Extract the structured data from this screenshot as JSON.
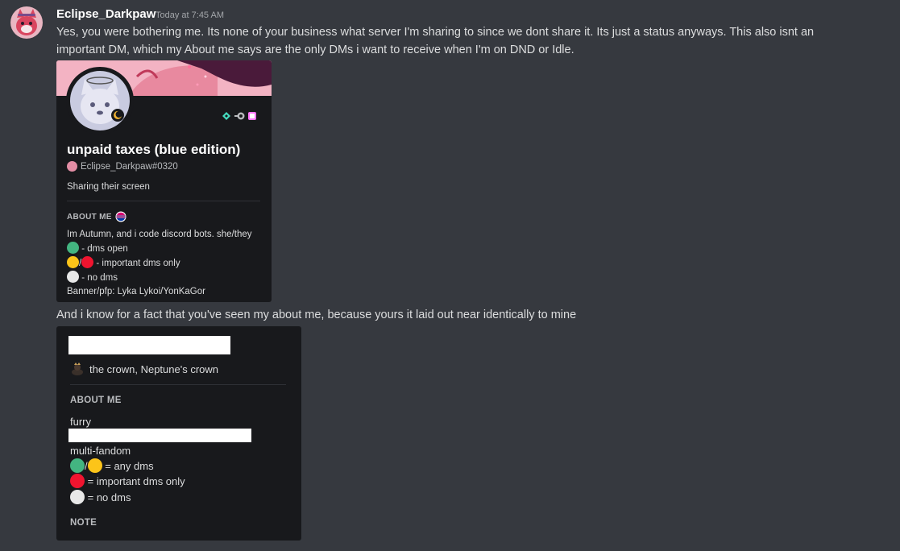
{
  "message": {
    "author": "Eclipse_Darkpaw",
    "timestamp": "Today at 7:45 AM",
    "text1": "Yes, you were bothering me. Its none of your business what server I'm sharing to since we dont share it. Its just a status anyways. This also isnt an important DM, which my About me says are the only DMs i want to receive when I'm on DND or Idle.",
    "text2": "And i know for a fact that you've seen my about me, because yours it laid out near identically to mine"
  },
  "card1": {
    "display_name": "unpaid taxes (blue edition)",
    "tag": "Eclipse_Darkpaw#0320",
    "activity": "Sharing their screen",
    "about_heading": "ABOUT ME",
    "about_lines": {
      "l1": "Im Autumn, and i code discord bots.  she/they",
      "l2": "- dms open",
      "l3_sep": "/",
      "l3": "- important dms only",
      "l4": "- no dms",
      "l5": "Banner/pfp: Lyka Lykoi/YonKaGor"
    },
    "status": "idle"
  },
  "card2": {
    "custom_status": "the crown, Neptune's crown",
    "about_heading": "ABOUT ME",
    "line_furry": "furry",
    "line_multi": "multi-fandom",
    "sep": "/",
    "line_any": "= any dms",
    "line_important": "= important dms only",
    "line_no": "= no dms",
    "note_heading": "NOTE"
  },
  "colors": {
    "background": "#36393f",
    "card": "#18191c",
    "green": "#43b581",
    "yellow": "#fcc419",
    "red": "#f0142f",
    "white": "#e8e8e8"
  }
}
